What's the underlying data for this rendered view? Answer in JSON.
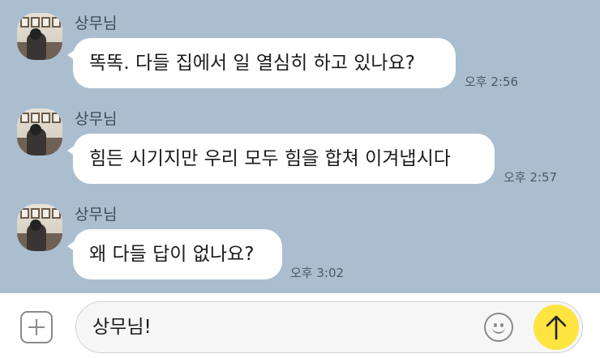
{
  "messages": [
    {
      "sender": "상무님",
      "text": "똑똑. 다들 집에서 일 열심히 하고 있나요?",
      "time": "오후 2:56"
    },
    {
      "sender": "상무님",
      "text": "힘든 시기지만 우리 모두 힘을 합쳐 이겨냅시다",
      "time": "오후 2:57"
    },
    {
      "sender": "상무님",
      "text": "왜 다들 답이 없나요?",
      "time": "오후 3:02"
    }
  ],
  "composer": {
    "input_value": "상무님!"
  },
  "colors": {
    "background": "#abbed0",
    "bubble": "#ffffff",
    "send_button": "#fde440"
  }
}
